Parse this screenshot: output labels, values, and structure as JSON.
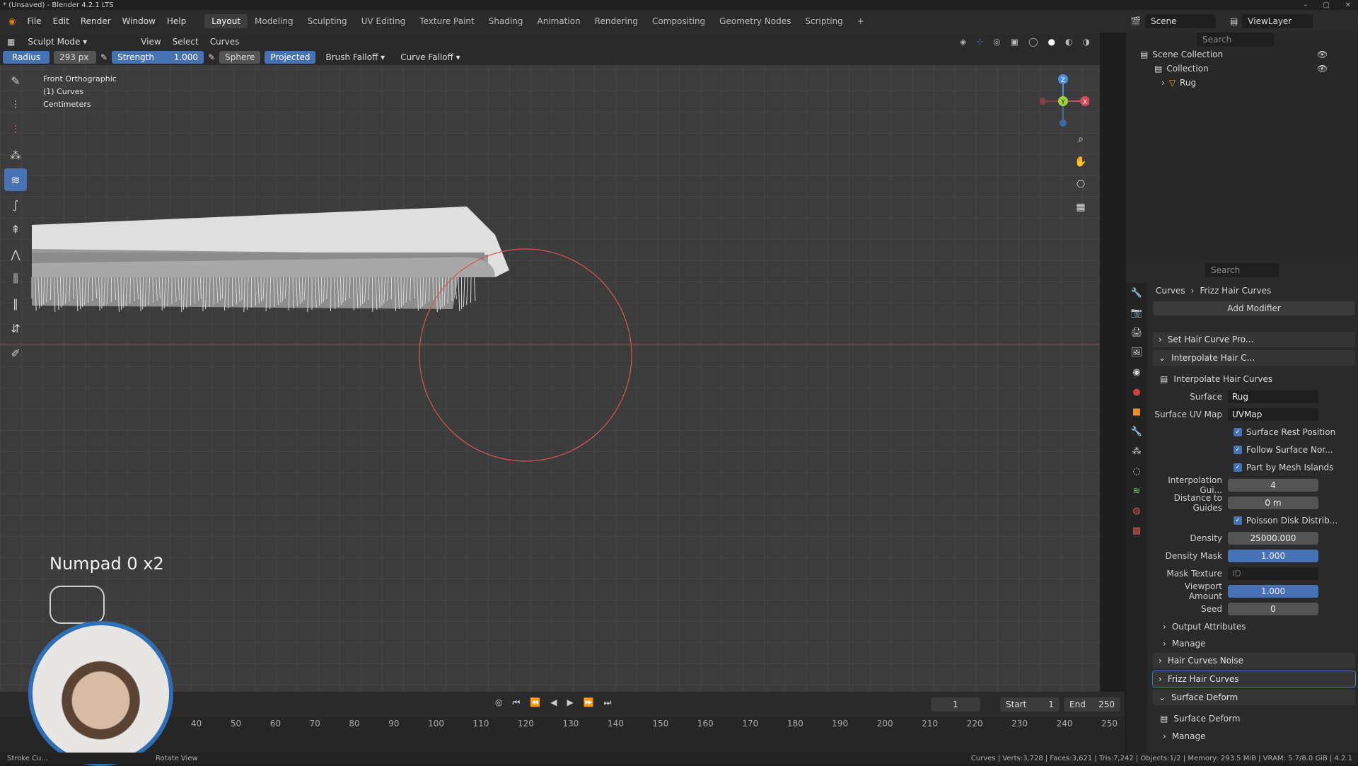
{
  "window": {
    "title": "* (Unsaved) - Blender 4.2.1 LTS"
  },
  "menus": [
    "File",
    "Edit",
    "Render",
    "Window",
    "Help"
  ],
  "workspaces": [
    "Layout",
    "Modeling",
    "Sculpting",
    "UV Editing",
    "Texture Paint",
    "Shading",
    "Animation",
    "Rendering",
    "Compositing",
    "Geometry Nodes",
    "Scripting"
  ],
  "scene": {
    "name": "Scene",
    "viewlayer": "ViewLayer"
  },
  "viewport_header": {
    "mode": "Sculpt Mode",
    "menus": [
      "View",
      "Select",
      "Curves"
    ]
  },
  "tool_options": {
    "radius_label": "Radius",
    "radius_value": "293 px",
    "strength_label": "Strength",
    "strength_value": "1.000",
    "sphere": "Sphere",
    "projected": "Projected",
    "brush_falloff": "Brush Falloff",
    "curve_falloff": "Curve Falloff"
  },
  "viewport_info": {
    "view": "Front Orthographic",
    "object": "(1) Curves",
    "units": "Centimeters"
  },
  "key_hint": "Numpad 0 x2",
  "gizmo": {
    "z": "Z",
    "y": "Y",
    "x": "X"
  },
  "outliner": {
    "search_placeholder": "Search",
    "scene_collection": "Scene Collection",
    "collection": "Collection",
    "rug": "Rug"
  },
  "properties": {
    "search_placeholder": "Search",
    "breadcrumb_obj": "Curves",
    "breadcrumb_mod": "Frizz Hair Curves",
    "add_modifier": "Add Modifier",
    "modifiers": [
      "Set Hair Curve Pro...",
      "Interpolate Hair C..."
    ],
    "node_group": "Interpolate Hair Curves",
    "surface_label": "Surface",
    "surface_value": "Rug",
    "uvmap_label": "Surface UV Map",
    "uvmap_value": "UVMap",
    "surface_rest": "Surface Rest Position",
    "follow_normal": "Follow Surface Nor...",
    "part_islands": "Part by Mesh Islands",
    "interp_guides_label": "Interpolation Gui...",
    "interp_guides_value": "4",
    "dist_guides_label": "Distance to Guides",
    "dist_guides_value": "0 m",
    "poisson": "Poisson Disk Distrib...",
    "density_label": "Density",
    "density_value": "25000.000",
    "density_mask_label": "Density Mask",
    "density_mask_value": "1.000",
    "mask_texture_label": "Mask Texture",
    "mask_texture_value": "ID",
    "viewport_amount_label": "Viewport Amount",
    "viewport_amount_value": "1.000",
    "seed_label": "Seed",
    "seed_value": "0",
    "output_attributes": "Output Attributes",
    "manage": "Manage",
    "mod_noise": "Hair Curves Noise",
    "mod_frizz": "Frizz Hair Curves",
    "mod_surface": "Surface Deform",
    "surface_deform_group": "Surface Deform",
    "manage2": "Manage"
  },
  "timeline": {
    "current": "1",
    "start_label": "Start",
    "start": "1",
    "end_label": "End",
    "end": "250",
    "ticks": [
      "40",
      "50",
      "60",
      "70",
      "80",
      "90",
      "100",
      "110",
      "120",
      "130",
      "140",
      "150",
      "160",
      "170",
      "180",
      "190",
      "200",
      "210",
      "220",
      "230",
      "240",
      "250"
    ]
  },
  "statusbar": {
    "left": "Stroke Cu...",
    "mid": "Rotate View",
    "stats": "Curves | Verts:3,728 | Faces:3,621 | Tris:7,242 | Objects:1/2 | Memory: 293.5 MiB | VRAM: 5.7/8.0 GiB | 4.2.1"
  }
}
